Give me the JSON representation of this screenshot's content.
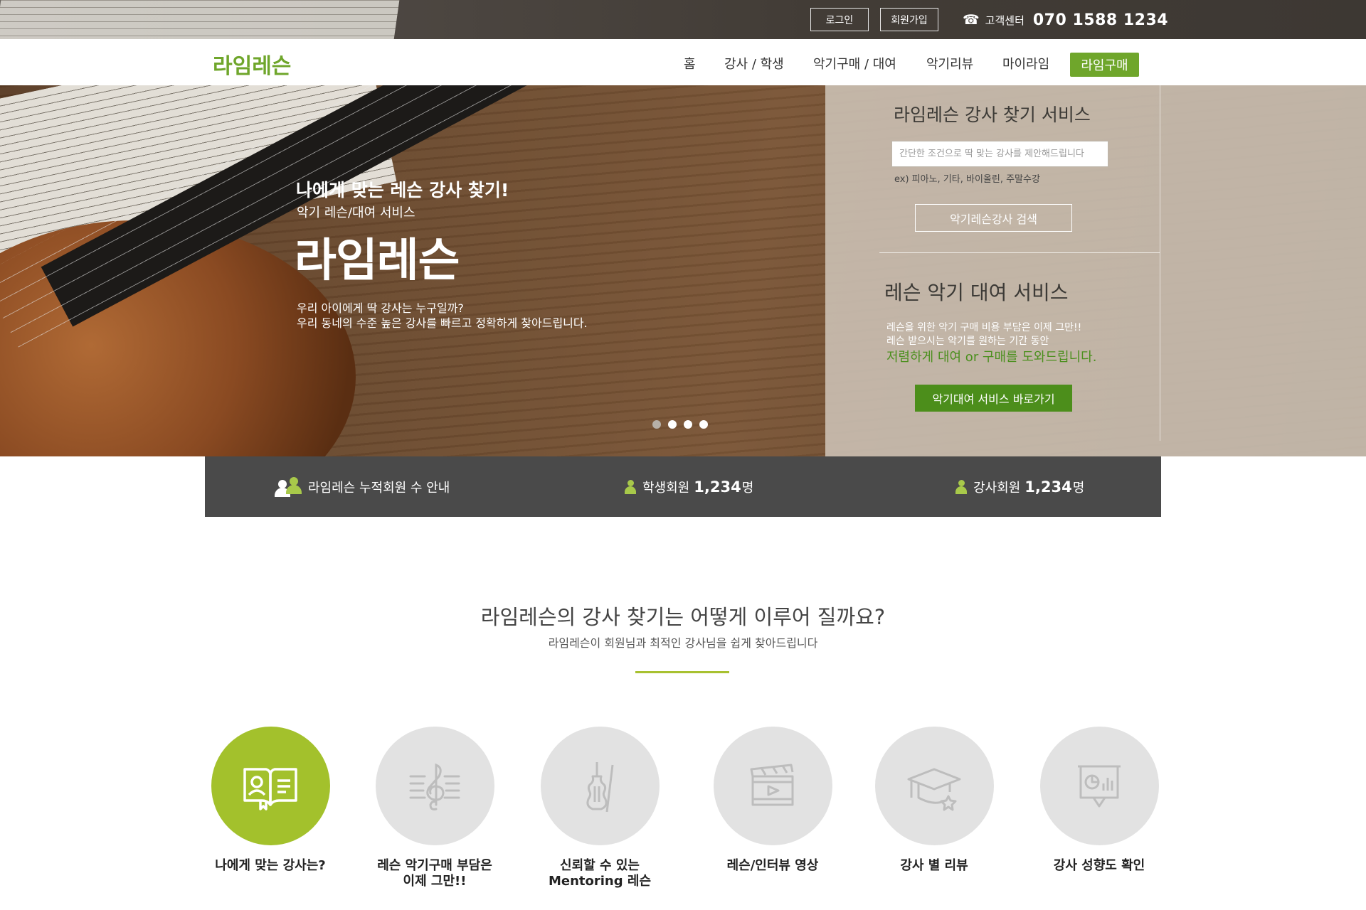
{
  "topbar": {
    "login_label": "로그인",
    "join_label": "회원가입",
    "cs_icon": "phone-icon",
    "cs_label": "고객센터",
    "cs_number": "070 1588 1234"
  },
  "nav": {
    "logo": "라임레슨",
    "items": [
      {
        "label": "홈"
      },
      {
        "label": "강사 / 학생"
      },
      {
        "label": "악기구매 / 대여"
      },
      {
        "label": "악기리뷰"
      },
      {
        "label": "마이라임"
      }
    ],
    "buy_label": "라임구매",
    "accent_color": "#6fa62b"
  },
  "hero": {
    "sub1": "나에게 맞는 레슨 강사 찾기!",
    "sub2": "악기 레슨/대여 서비스",
    "title": "라임레슨",
    "desc1": "우리 아이에게 딱 강사는 누구일까?",
    "desc2": "우리 동네의 수준 높은 강사를 빠르고 정확하게 찾아드립니다.",
    "slides_total": 4,
    "slide_active": 1
  },
  "panel": {
    "title1": "라임레슨 강사 찾기 서비스",
    "search_placeholder": "간단한 조건으로 딱 맞는 강사를 제안해드립니다",
    "example": "ex) 피아노, 기타, 바이올린, 주말수강",
    "search_button": "악기레슨강사 검색",
    "title2": "레슨 악기 대여 서비스",
    "desc1": "레슨을 위한 악기 구매 비용 부담은 이제 그만!!",
    "desc2": "레슨 받으시는 악기를 원하는 기간 동안",
    "desc3": "저렴하게 대여 or 구매를 도와드립니다.",
    "rental_button": "악기대여 서비스 바로가기"
  },
  "stats": {
    "total_label": "라임레슨 누적회원 수 안내",
    "student_label": "학생회원",
    "student_value": "1,234",
    "teacher_label": "강사회원",
    "teacher_value": "1,234",
    "unit": "명"
  },
  "how": {
    "title": "라임레슨의 강사 찾기는 어떻게 이루어 질까요?",
    "subtitle": "라임레슨이 회원님과 최적인 강사님을 쉽게 찾아드립니다",
    "features": [
      {
        "icon": "open-book-icon",
        "line1": "나에게 맞는 강사는?",
        "line2": ""
      },
      {
        "icon": "treble-clef-icon",
        "line1": "레슨 악기구매 부담은",
        "line2": "이제 그만!!"
      },
      {
        "icon": "violin-icon",
        "line1": "신뢰할 수 있는",
        "line2": "Mentoring 레슨"
      },
      {
        "icon": "video-clapper-icon",
        "line1": "레슨/인터뷰 영상",
        "line2": ""
      },
      {
        "icon": "graduation-cap-icon",
        "line1": "강사 별 리뷰",
        "line2": ""
      },
      {
        "icon": "presentation-chart-icon",
        "line1": "강사 성향도 확인",
        "line2": ""
      }
    ],
    "active_color": "#a3c12c"
  }
}
